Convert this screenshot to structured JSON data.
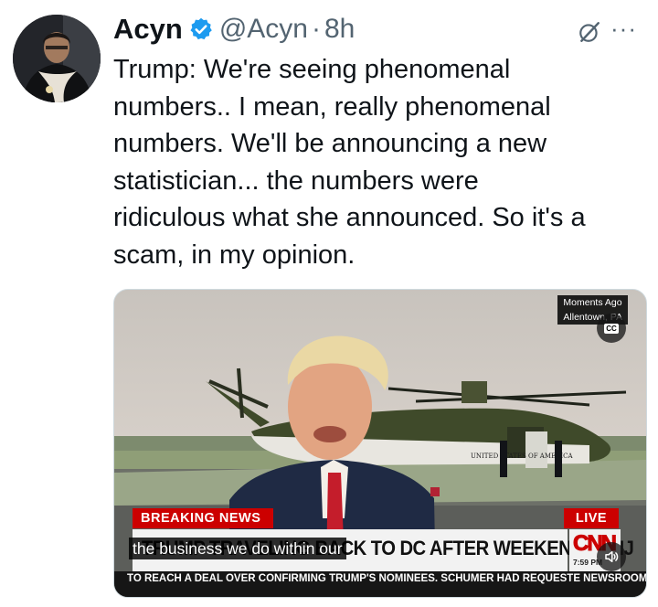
{
  "author": {
    "name": "Acyn",
    "handle": "@Acyn",
    "separator": "·",
    "time": "8h"
  },
  "tweet": {
    "text": "Trump: We're seeing phenomenal\nnumbers.. I mean, really phenomenal\nnumbers. We'll be announcing a new\nstatistician... the numbers were\nridiculous what she announced.  So it's a\nscam, in my opinion."
  },
  "video": {
    "moments_label": "Moments Ago",
    "location_label": "Allentown, PA",
    "cc_label": "CC",
    "breaking_label": "BREAKING NEWS",
    "live_label": "LIVE",
    "headline": "TRUMP TRAVELING BACK TO DC AFTER WEEKEND IN NJ",
    "caption": "the business we do within our",
    "network_logo": "CNN",
    "clock": "7:59 PM",
    "ticker": "TO REACH A DEAL OVER CONFIRMING TRUMP'S NOMINEES. SCHUMER HAD REQUESTE NEWSROOM",
    "aircraft_text": "UNITED STATES OF AMERICA"
  },
  "icons": {
    "verified": "verified-badge-icon",
    "grok": "grok-icon",
    "more": "more-icon",
    "mute": "speaker-icon"
  },
  "colors": {
    "verified_blue": "#1d9bf0",
    "cnn_red": "#cc0000",
    "text_primary": "#0f1419",
    "text_secondary": "#536471"
  }
}
